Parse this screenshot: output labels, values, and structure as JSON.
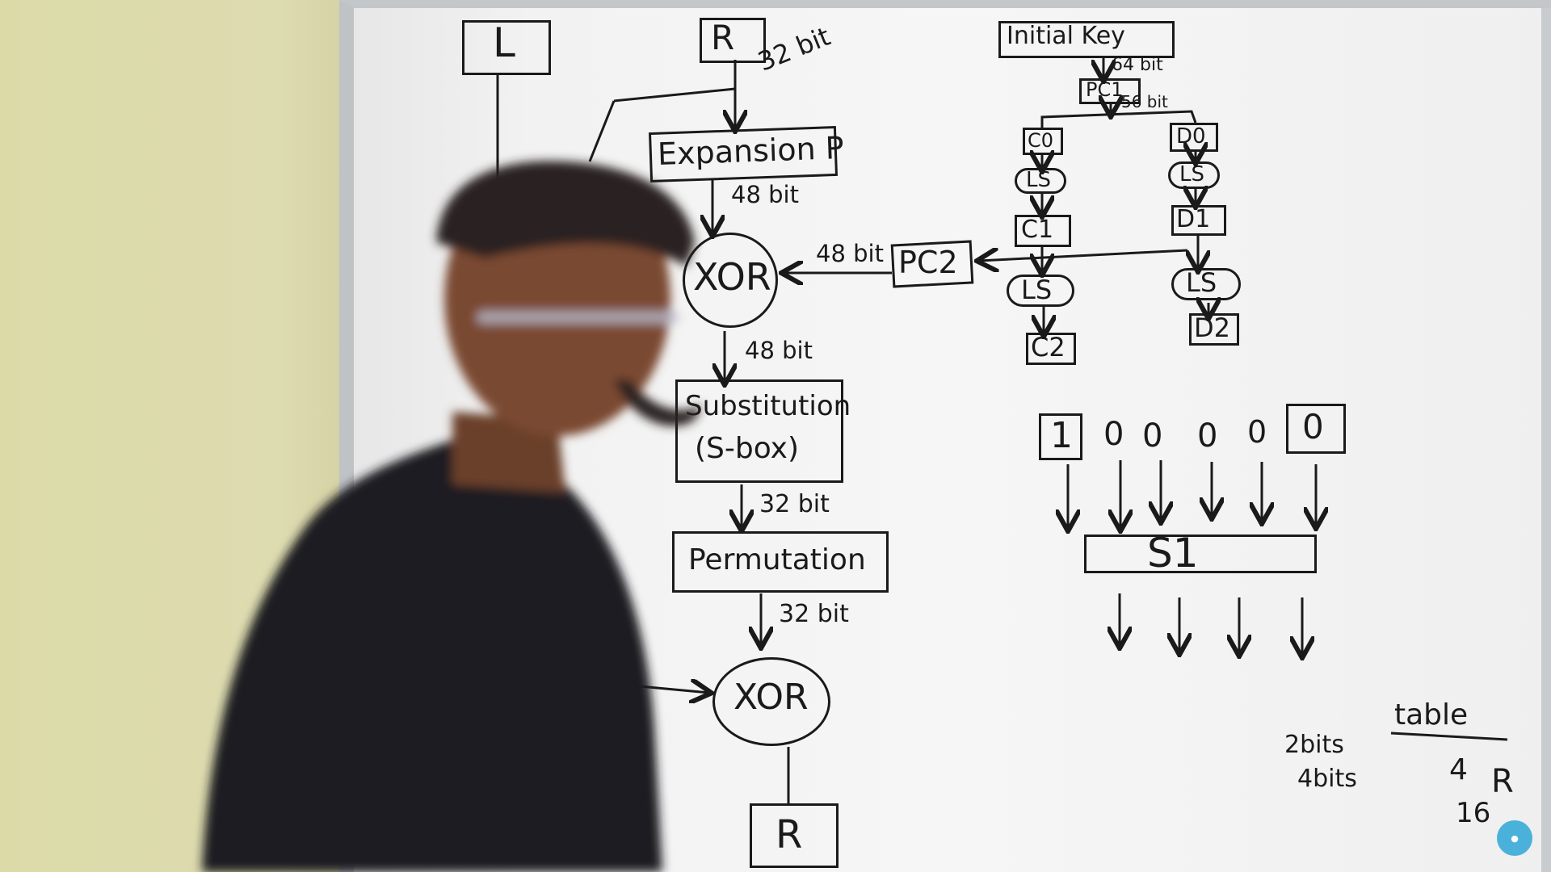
{
  "whiteboard": {
    "left_branch": {
      "L": "L",
      "R": "R",
      "r_width": "32 bit"
    },
    "round_function": {
      "expansion": "Expansion P",
      "after_expansion": "48 bit",
      "xor_top": "XOR",
      "xor_in_from_key": "48 bit",
      "after_xor": "48 bit",
      "substitution_line1": "Substitution",
      "substitution_line2": "(S-box)",
      "after_sbox": "32 bit",
      "permutation": "Permutation",
      "after_permutation": "32 bit",
      "xor_bottom": "XOR",
      "output_R": "R"
    },
    "key_schedule": {
      "initial_key": "Initial Key",
      "key_bits": "64 bit",
      "pc1": "PC1",
      "pc1_bits": "56 bit",
      "c0": "C0",
      "d0": "D0",
      "ls_c0": "LS",
      "ls_d0": "LS",
      "c1": "C1",
      "d1": "D1",
      "ls_c1": "LS",
      "ls_d1": "LS",
      "c2": "C2",
      "d2": "D2",
      "pc2": "PC2"
    },
    "sbox_example": {
      "input_bits": [
        "1",
        "0",
        "0",
        "0",
        "0",
        "0"
      ],
      "sbox_label": "S1",
      "note_table": "table",
      "note_2bits": "2bits",
      "note_4bits": "4bits",
      "note_4": "4",
      "note_R": "R",
      "note_16": "16"
    }
  }
}
